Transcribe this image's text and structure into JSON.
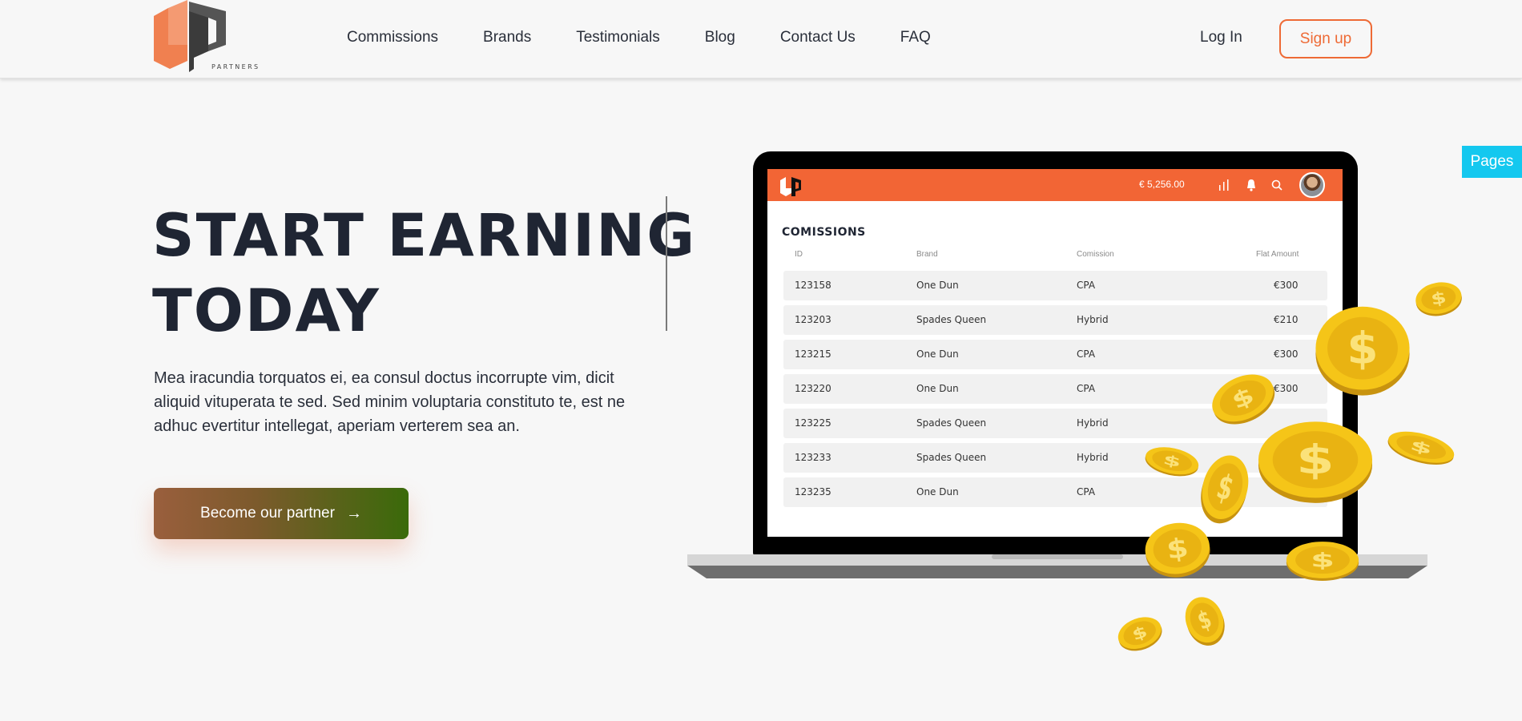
{
  "header": {
    "logo_text": "4P",
    "logo_subtitle": "PARTNERS",
    "nav": [
      "Commissions",
      "Brands",
      "Testimonials",
      "Blog",
      "Contact Us",
      "FAQ"
    ],
    "login_label": "Log In",
    "signup_label": "Sign up"
  },
  "hero": {
    "title_line1": "START EARNING",
    "title_line2": "TODAY",
    "description": "Mea iracundia torquatos ei, ea consul doctus incorrupte vim, dicit aliquid vituperata te sed. Sed minim voluptaria constituto te, est ne adhuc evertitur intellegat, aperiam verterem sea an.",
    "cta_label": "Become our partner",
    "cta_icon": "arrow-right-icon"
  },
  "dashboard": {
    "balance": "€ 5,256.00",
    "icons": [
      "bar-chart-icon",
      "bell-icon",
      "search-icon"
    ],
    "section_title": "COMISSIONS",
    "columns": [
      "ID",
      "Brand",
      "Comission",
      "Flat Amount"
    ],
    "rows": [
      {
        "id": "123158",
        "brand": "One Dun",
        "commission": "CPA",
        "amount": "€300"
      },
      {
        "id": "123203",
        "brand": "Spades Queen",
        "commission": "Hybrid",
        "amount": "€210"
      },
      {
        "id": "123215",
        "brand": "One Dun",
        "commission": "CPA",
        "amount": "€300"
      },
      {
        "id": "123220",
        "brand": "One Dun",
        "commission": "CPA",
        "amount": "€300"
      },
      {
        "id": "123225",
        "brand": "Spades Queen",
        "commission": "Hybrid",
        "amount": ""
      },
      {
        "id": "123233",
        "brand": "Spades Queen",
        "commission": "Hybrid",
        "amount": ""
      },
      {
        "id": "123235",
        "brand": "One Dun",
        "commission": "CPA",
        "amount": ""
      }
    ]
  },
  "side_tab": {
    "label": "Pages"
  },
  "colors": {
    "accent": "#f26535",
    "text": "#1f2533",
    "pages_tab": "#14c8ef",
    "coin": "#f5c518"
  }
}
